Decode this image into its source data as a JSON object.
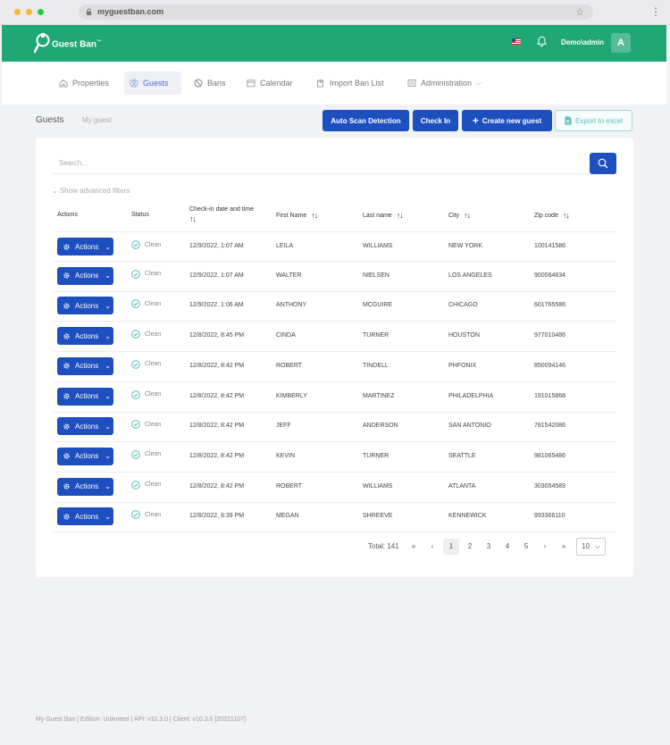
{
  "browser": {
    "url": "myguestban.com",
    "dots": [
      "#f6b73c",
      "#f6b73c",
      "#27c93f"
    ]
  },
  "header": {
    "app_name": "Guest Ban",
    "app_name_mark": "™",
    "user": "Demo\\admin",
    "avatar": "A",
    "accent": "#1fa774"
  },
  "nav": {
    "tabs": [
      {
        "label": "Properties",
        "icon": "house-icon",
        "active": false
      },
      {
        "label": "Guests",
        "icon": "users-icon",
        "active": true
      },
      {
        "label": "Bans",
        "icon": "ban-icon",
        "active": false
      },
      {
        "label": "Calendar",
        "icon": "calendar-icon",
        "active": false
      },
      {
        "label": "Import Ban List",
        "icon": "import-icon",
        "active": false
      },
      {
        "label": "Administration",
        "icon": "admin-icon",
        "active": false,
        "has_dropdown": true
      }
    ]
  },
  "page": {
    "title": "Guests",
    "subtitle": "My guest",
    "buttons": {
      "auto_scan": "Auto Scan Detection",
      "check_in": "Check In",
      "create_guest": "Create new guest",
      "export": "Export to excel"
    }
  },
  "search": {
    "placeholder": "Search...",
    "advanced": "Show advanced filters"
  },
  "table": {
    "columns": [
      "Actions",
      "Status",
      "Check-in date and time",
      "First Name",
      "Last name",
      "City",
      "Zip code"
    ],
    "action_label": "Actions",
    "rows": [
      {
        "status": "Clean",
        "date": "12/9/2022, 1:07 AM",
        "first": "LEILA",
        "last": "WILLIAMS",
        "city": "NEW YORK",
        "zip": "100141586"
      },
      {
        "status": "Clean",
        "date": "12/9/2022, 1:07 AM",
        "first": "WALTER",
        "last": "NIELSEN",
        "city": "LOS ANGELES",
        "zip": "900064834"
      },
      {
        "status": "Clean",
        "date": "12/9/2022, 1:06 AM",
        "first": "ANTHONY",
        "last": "MCGUIRE",
        "city": "CHICAGO",
        "zip": "601765586"
      },
      {
        "status": "Clean",
        "date": "12/8/2022, 8:45 PM",
        "first": "CINDA",
        "last": "TURNER",
        "city": "HOUSTON",
        "zip": "977010486"
      },
      {
        "status": "Clean",
        "date": "12/8/2022, 8:42 PM",
        "first": "ROBERT",
        "last": "TINDELL",
        "city": "PHFONIX",
        "zip": "850094146"
      },
      {
        "status": "Clean",
        "date": "12/8/2022, 8:42 PM",
        "first": "KIMBERLY",
        "last": "MARTINEZ",
        "city": "PHILADELPHIA",
        "zip": "191015868"
      },
      {
        "status": "Clean",
        "date": "12/8/2022, 8:42 PM",
        "first": "JEFF",
        "last": "ANDERSON",
        "city": "SAN ANTONIO",
        "zip": "781542086"
      },
      {
        "status": "Clean",
        "date": "12/8/2022, 8:42 PM",
        "first": "KEVIN",
        "last": "TURNER",
        "city": "SEATTLE",
        "zip": "981065486"
      },
      {
        "status": "Clean",
        "date": "12/8/2022, 8:42 PM",
        "first": "ROBERT",
        "last": "WILLIAMS",
        "city": "ATLANTA",
        "zip": "303054589"
      },
      {
        "status": "Clean",
        "date": "12/8/2022, 8:39 PM",
        "first": "MEGAN",
        "last": "SHREEVE",
        "city": "KENNEWICK",
        "zip": "993366110"
      }
    ]
  },
  "pagination": {
    "total": "Total: 141",
    "first": "«",
    "prev": "‹",
    "pages": [
      "1",
      "2",
      "3",
      "4",
      "5"
    ],
    "current": "1",
    "next": "›",
    "last": "»",
    "page_size": "10"
  },
  "footer": "My Guest Ban | Edition: Unlimited | API: v10.3.0 | Client: v10.3.0 [20221107]"
}
